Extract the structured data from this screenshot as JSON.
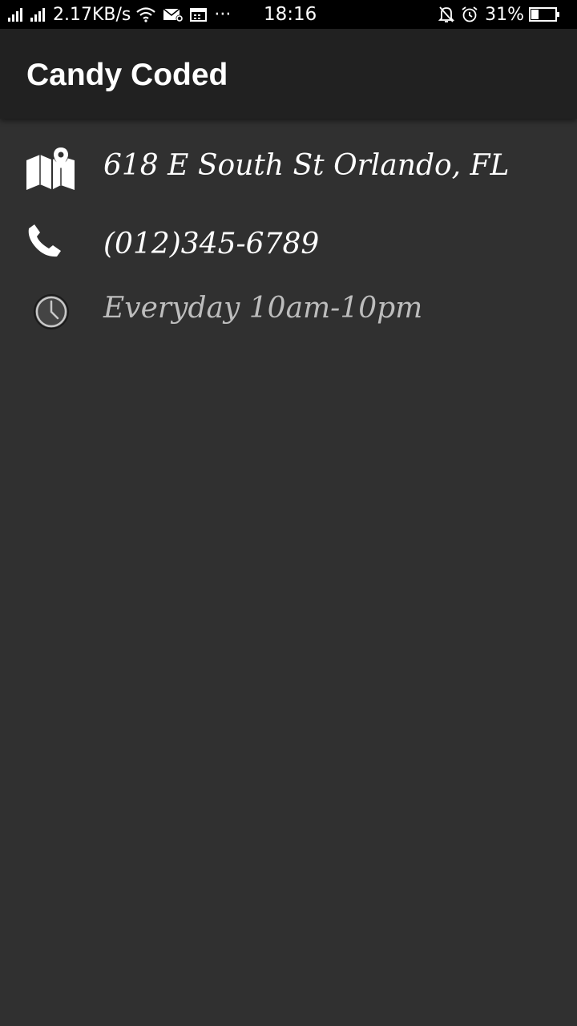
{
  "status_bar": {
    "network_speed": "2.17KB/s",
    "dots": "···",
    "time": "18:16",
    "battery_percent": "31%",
    "battery_level": 0.31,
    "icons": [
      "signal-icon",
      "signal-icon",
      "wifi-icon",
      "mail-settings-icon",
      "calendar-icon",
      "bell-off-icon",
      "alarm-icon",
      "battery-icon"
    ]
  },
  "app_bar": {
    "title": "Candy Coded"
  },
  "info": {
    "address": "618 E South St Orlando, FL",
    "phone": "(012)345-6789",
    "hours": "Everyday 10am-10pm",
    "icons": [
      "map-icon",
      "phone-icon",
      "clock-icon"
    ]
  },
  "colors": {
    "background": "#303030",
    "app_bar": "#212121",
    "status_bar": "#000000",
    "text": "#ffffff",
    "hours_text": "#bdbdbd"
  }
}
